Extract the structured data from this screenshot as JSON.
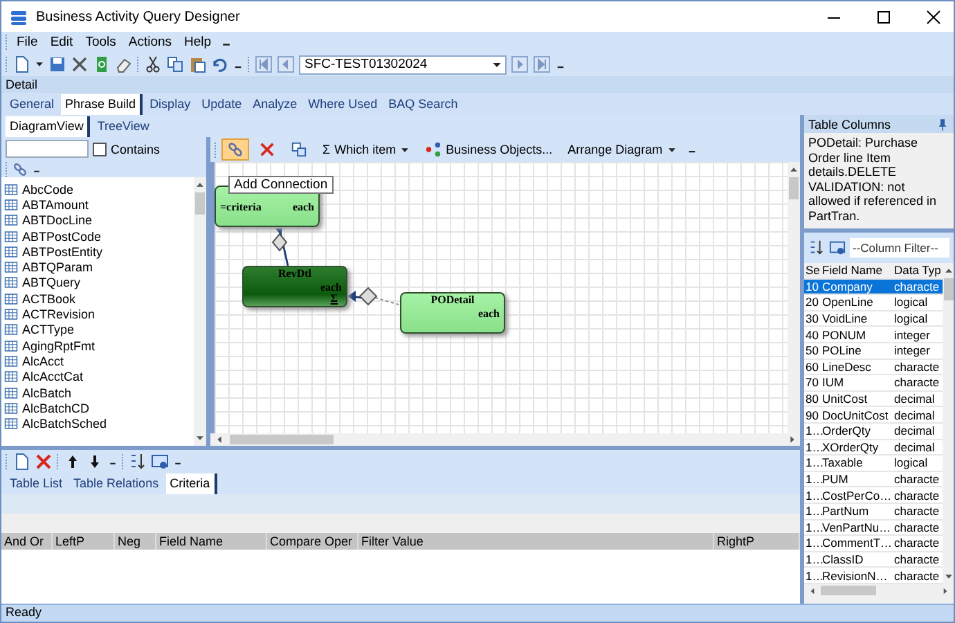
{
  "window": {
    "title": "Business Activity Query Designer"
  },
  "menu": [
    "File",
    "Edit",
    "Tools",
    "Actions",
    "Help"
  ],
  "toolbar": {
    "record": "SFC-TEST01302024"
  },
  "detail_label": "Detail",
  "tabs": [
    {
      "label": "General",
      "selected": false
    },
    {
      "label": "Phrase Build",
      "selected": true
    },
    {
      "label": "Display",
      "selected": false
    },
    {
      "label": "Update",
      "selected": false
    },
    {
      "label": "Analyze",
      "selected": false
    },
    {
      "label": "Where Used",
      "selected": false
    },
    {
      "label": "BAQ Search",
      "selected": false
    }
  ],
  "sub_tabs": [
    {
      "label": "DiagramView",
      "selected": true
    },
    {
      "label": "TreeView",
      "selected": false
    }
  ],
  "filter": {
    "label": "Contains",
    "checked": false
  },
  "table_list": [
    "AbcCode",
    "ABTAmount",
    "ABTDocLine",
    "ABTPostCode",
    "ABTPostEntity",
    "ABTQParam",
    "ABTQuery",
    "ACTBook",
    "ACTRevision",
    "ACTType",
    "AgingRptFmt",
    "AlcAcct",
    "AlcAcctCat",
    "AlcBatch",
    "AlcBatchCD",
    "AlcBatchSched"
  ],
  "diagram_tools": [
    {
      "kind": "connect",
      "selected": true
    },
    {
      "kind": "delete",
      "selected": false
    },
    {
      "kind": "copy",
      "selected": false
    },
    {
      "kind": "sum",
      "symbol": "Σ",
      "label": "Which item",
      "dropdown": true,
      "selected": false
    },
    {
      "kind": "objects",
      "label": "Business Objects...",
      "dropdown": false,
      "selected": false
    },
    {
      "kind": "arrange",
      "label": "Arrange Diagram",
      "dropdown": true,
      "selected": false
    }
  ],
  "diagram": {
    "tooltip": "Add Connection",
    "nodes": [
      {
        "left_text": "=criteria",
        "right_text": "each",
        "selected": false
      },
      {
        "title": "RevDtl",
        "right_text": "each",
        "symbol": "Σ",
        "selected": true
      },
      {
        "title": "PODetail",
        "right_text": "each",
        "selected": false
      }
    ]
  },
  "table_columns": {
    "title": "Table Columns",
    "description": "PODetail: Purchase Order line Item details.DELETE VALIDATION: not allowed if referenced in PartTran.",
    "filter_placeholder": "--Column Filter--",
    "columns": [
      "Se",
      "Field Name",
      "Data Typ"
    ],
    "rows": [
      {
        "seq": "10",
        "name": "Company",
        "type": "characte",
        "selected": true
      },
      {
        "seq": "20",
        "name": "OpenLine",
        "type": "logical",
        "selected": false
      },
      {
        "seq": "30",
        "name": "VoidLine",
        "type": "logical",
        "selected": false
      },
      {
        "seq": "40",
        "name": "PONUM",
        "type": "integer",
        "selected": false
      },
      {
        "seq": "50",
        "name": "POLine",
        "type": "integer",
        "selected": false
      },
      {
        "seq": "60",
        "name": "LineDesc",
        "type": "characte",
        "selected": false
      },
      {
        "seq": "70",
        "name": "IUM",
        "type": "characte",
        "selected": false
      },
      {
        "seq": "80",
        "name": "UnitCost",
        "type": "decimal",
        "selected": false
      },
      {
        "seq": "90",
        "name": "DocUnitCost",
        "type": "decimal",
        "selected": false
      },
      {
        "seq": "1…",
        "name": "OrderQty",
        "type": "decimal",
        "selected": false
      },
      {
        "seq": "1…",
        "name": "XOrderQty",
        "type": "decimal",
        "selected": false
      },
      {
        "seq": "1…",
        "name": "Taxable",
        "type": "logical",
        "selected": false
      },
      {
        "seq": "1…",
        "name": "PUM",
        "type": "characte",
        "selected": false
      },
      {
        "seq": "1…",
        "name": "CostPerCo…",
        "type": "characte",
        "selected": false
      },
      {
        "seq": "1…",
        "name": "PartNum",
        "type": "characte",
        "selected": false
      },
      {
        "seq": "1…",
        "name": "VenPartNu…",
        "type": "characte",
        "selected": false
      },
      {
        "seq": "1…",
        "name": "CommentT…",
        "type": "characte",
        "selected": false
      },
      {
        "seq": "1…",
        "name": "ClassID",
        "type": "characte",
        "selected": false
      },
      {
        "seq": "1…",
        "name": "RevisionN…",
        "type": "characte",
        "selected": false
      }
    ]
  },
  "bottom_tabs": [
    {
      "label": "Table List",
      "selected": false
    },
    {
      "label": "Table Relations",
      "selected": false
    },
    {
      "label": "Criteria",
      "selected": true
    }
  ],
  "criteria_columns": [
    "And Or",
    "LeftP",
    "Neg",
    "Field Name",
    "Compare Oper",
    "Filter Value",
    "RightP"
  ],
  "status_bar": "Ready"
}
